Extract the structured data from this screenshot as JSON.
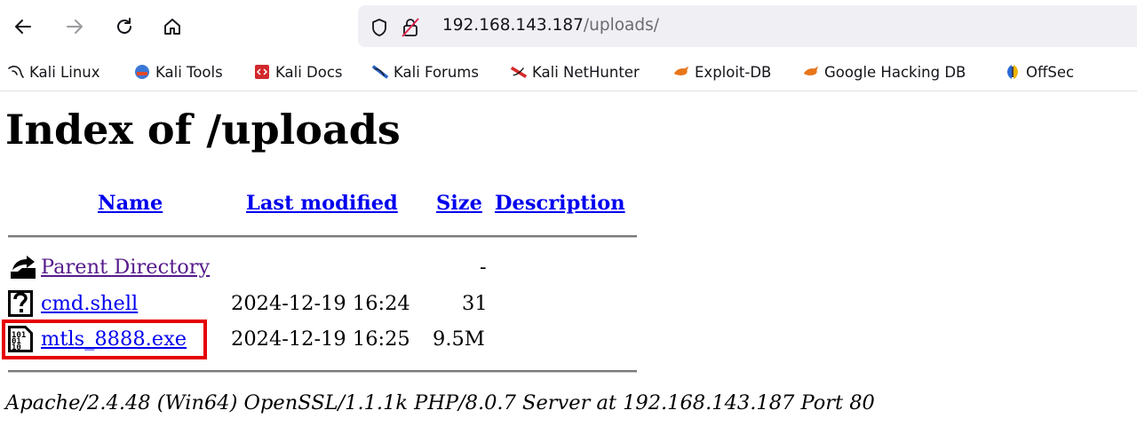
{
  "browser": {
    "url_host": "192.168.143.187",
    "url_path": "/uploads/",
    "bookmarks": [
      {
        "label": "Kali Linux",
        "icon": "kali-dragon-icon"
      },
      {
        "label": "Kali Tools",
        "icon": "kali-tools-icon"
      },
      {
        "label": "Kali Docs",
        "icon": "kali-docs-icon"
      },
      {
        "label": "Kali Forums",
        "icon": "kali-forums-icon"
      },
      {
        "label": "Kali NetHunter",
        "icon": "kali-nethunter-icon"
      },
      {
        "label": "Exploit-DB",
        "icon": "exploit-db-icon"
      },
      {
        "label": "Google Hacking DB",
        "icon": "exploit-db-icon"
      },
      {
        "label": "OffSec",
        "icon": "offsec-icon"
      }
    ]
  },
  "page": {
    "title": "Index of /uploads",
    "columns": {
      "name": "Name",
      "last_modified": "Last modified",
      "size": "Size",
      "description": "Description"
    },
    "rows": [
      {
        "name": "Parent Directory",
        "last_modified": "",
        "size": "-",
        "icon": "back-folder-icon"
      },
      {
        "name": "cmd.shell",
        "last_modified": "2024-12-19 16:24",
        "size": "31",
        "icon": "unknown-file-icon"
      },
      {
        "name": "mtls_8888.exe",
        "last_modified": "2024-12-19 16:25",
        "size": "9.5M",
        "icon": "binary-file-icon"
      }
    ],
    "footer": "Apache/2.4.48 (Win64) OpenSSL/1.1.1k PHP/8.0.7 Server at 192.168.143.187 Port 80"
  },
  "colors": {
    "link": "#0000ee",
    "visited": "#551a8b",
    "highlight": "#e60000"
  }
}
